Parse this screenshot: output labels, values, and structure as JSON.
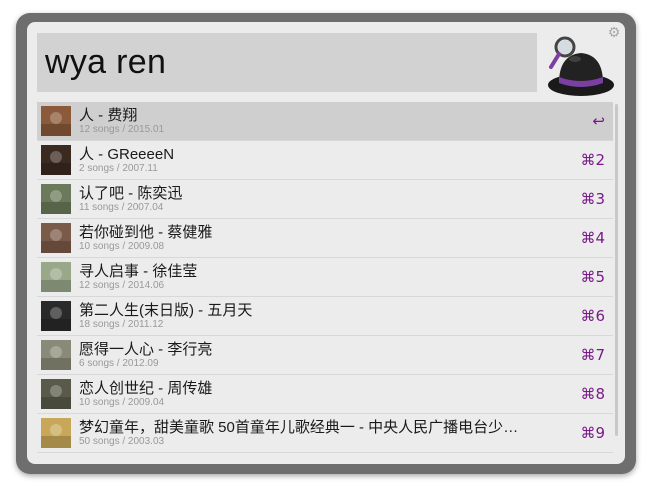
{
  "search": {
    "query": "wya ren"
  },
  "settings_icon": "gear-icon",
  "logo_icon": "alfred-hat-icon",
  "results": [
    {
      "title": "人 - 费翔",
      "subtitle": "12 songs / 2015.01",
      "shortcut": "↩",
      "thumb_color": "#8a5a3a"
    },
    {
      "title": "人 - GReeeeN",
      "subtitle": "2 songs / 2007.11",
      "shortcut": "⌘2",
      "thumb_color": "#3a2a20"
    },
    {
      "title": "认了吧 - 陈奕迅",
      "subtitle": "11 songs / 2007.04",
      "shortcut": "⌘3",
      "thumb_color": "#6b7a5a"
    },
    {
      "title": "若你碰到他 - 蔡健雅",
      "subtitle": "10 songs / 2009.08",
      "shortcut": "⌘4",
      "thumb_color": "#7a5a48"
    },
    {
      "title": "寻人启事 - 徐佳莹",
      "subtitle": "12 songs / 2014.06",
      "shortcut": "⌘5",
      "thumb_color": "#9aa88a"
    },
    {
      "title": "第二人生(末日版) - 五月天",
      "subtitle": "18 songs / 2011.12",
      "shortcut": "⌘6",
      "thumb_color": "#2a2a2a"
    },
    {
      "title": "愿得一人心 - 李行亮",
      "subtitle": "6 songs / 2012.09",
      "shortcut": "⌘7",
      "thumb_color": "#8a8a78"
    },
    {
      "title": "恋人创世纪 - 周传雄",
      "subtitle": "10 songs / 2009.04",
      "shortcut": "⌘8",
      "thumb_color": "#5a5a4a"
    },
    {
      "title": "梦幻童年，甜美童歌 50首童年儿歌经典一 - 中央人民广播电台少年…",
      "subtitle": "50 songs / 2003.03",
      "shortcut": "⌘9",
      "thumb_color": "#c8a858"
    }
  ]
}
